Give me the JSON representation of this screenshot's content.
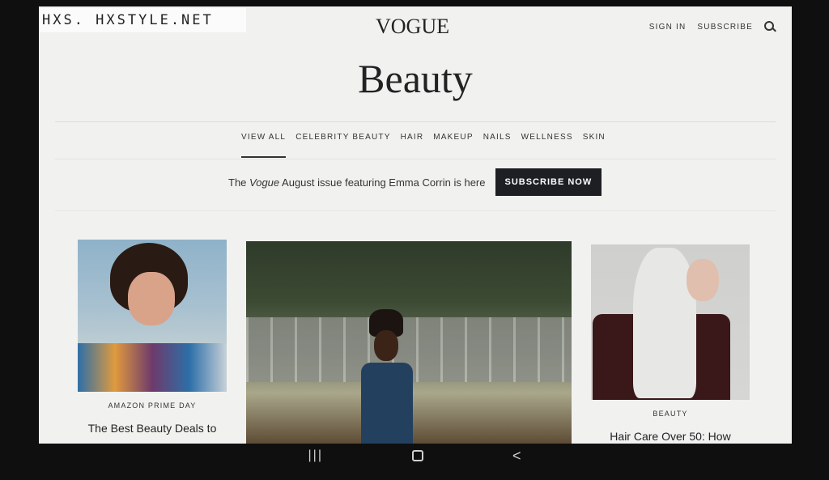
{
  "watermark": {
    "text": "HXS. HXSTYLE.NET"
  },
  "header": {
    "logo": "VOGUE",
    "sign_in": "SIGN IN",
    "subscribe": "SUBSCRIBE",
    "search_icon": "search-icon"
  },
  "page": {
    "title": "Beauty"
  },
  "nav": {
    "items": [
      "VIEW ALL",
      "CELEBRITY BEAUTY",
      "HAIR",
      "MAKEUP",
      "NAILS",
      "WELLNESS",
      "SKIN"
    ],
    "active_index": 0
  },
  "promo": {
    "text_prefix": "The",
    "text_italic": "Vogue",
    "text_suffix": "August issue featuring Emma Corrin is here",
    "button_label": "SUBSCRIBE NOW",
    "button_color": "#1d1f22"
  },
  "articles": {
    "left": {
      "kicker": "AMAZON PRIME DAY",
      "headline": "The Best Beauty Deals to"
    },
    "right": {
      "kicker": "BEAUTY",
      "headline": "Hair Care Over 50: How"
    }
  },
  "system_nav": {
    "recent_icon": "recent-apps-icon",
    "home_icon": "home-icon",
    "back_icon": "back-icon",
    "recent_label": "|||",
    "back_label": "<"
  }
}
